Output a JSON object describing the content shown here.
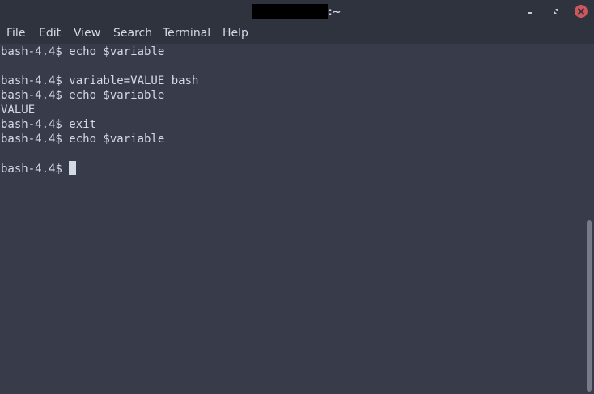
{
  "window": {
    "title_suffix": ":~"
  },
  "menu": {
    "items": [
      "File",
      "Edit",
      "View",
      "Search",
      "Terminal",
      "Help"
    ]
  },
  "terminal": {
    "lines": [
      "bash-4.4$ echo $variable",
      "",
      "bash-4.4$ variable=VALUE bash",
      "bash-4.4$ echo $variable",
      "VALUE",
      "bash-4.4$ exit",
      "bash-4.4$ echo $variable",
      "",
      "bash-4.4$ "
    ]
  },
  "icons": {
    "minimize": "minimize-icon",
    "maximize": "maximize-icon",
    "close": "close-icon"
  },
  "colors": {
    "background": "#383c4a",
    "titlebar": "#2f333d",
    "text": "#d3dae3",
    "close_button": "#cc575d",
    "scrollbar_thumb": "#767b87"
  }
}
